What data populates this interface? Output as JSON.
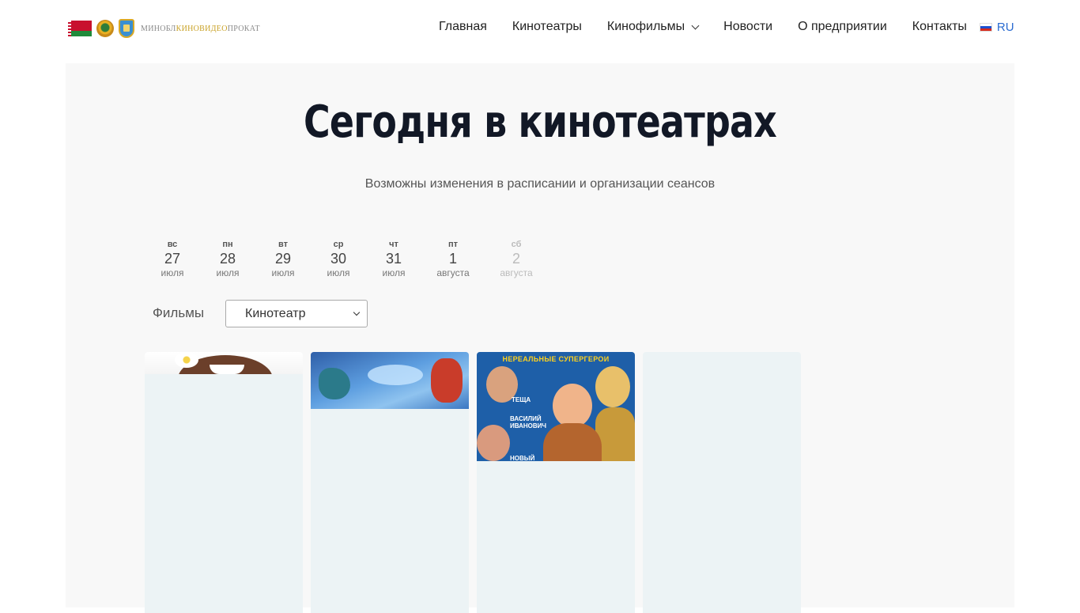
{
  "header": {
    "logo_text_1": "МИНОБЛ",
    "logo_text_2": "КИНОВИДЕО",
    "logo_text_3": "ПРОКАТ",
    "nav": [
      {
        "label": "Главная"
      },
      {
        "label": "Кинотеатры"
      },
      {
        "label": "Кинофильмы"
      },
      {
        "label": "Новости"
      },
      {
        "label": "О предприятии"
      },
      {
        "label": "Контакты"
      }
    ],
    "language": "RU"
  },
  "main": {
    "title": "Сегодня в кинотеатрах",
    "subtitle": "Возможны изменения в расписании и организации сеансов",
    "dates": [
      {
        "dow": "вс",
        "day": "27",
        "month": "июля",
        "disabled": false
      },
      {
        "dow": "пн",
        "day": "28",
        "month": "июля",
        "disabled": false
      },
      {
        "dow": "вт",
        "day": "29",
        "month": "июля",
        "disabled": false
      },
      {
        "dow": "ср",
        "day": "30",
        "month": "июля",
        "disabled": false
      },
      {
        "dow": "чт",
        "day": "31",
        "month": "июля",
        "disabled": false
      },
      {
        "dow": "пт",
        "day": "1",
        "month": "августа",
        "disabled": false
      },
      {
        "dow": "сб",
        "day": "2",
        "month": "августа",
        "disabled": true
      }
    ],
    "filter_label": "Фильмы",
    "cinema_select": "Кинотеатр",
    "cards": [
      {
        "poster_title": ""
      },
      {
        "poster_title": ""
      },
      {
        "poster_title": "НЕРЕАЛЬНЫЕ СУПЕРГЕРОИ",
        "tag_1": "ТЕЩА",
        "tag_2": "ВАСИЛИЙ ИВАНОВИЧ",
        "tag_3": "НОВЫЙ"
      },
      {
        "poster_title": ""
      }
    ]
  },
  "colors": {
    "title": "#121826",
    "main_bg": "#f8f8f8",
    "card_bg": "#ecf3f5",
    "lang_link": "#2a6bd1"
  }
}
